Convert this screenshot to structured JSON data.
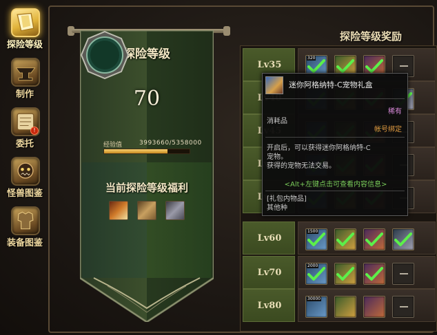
{
  "nav": {
    "items": [
      {
        "label": "探险等级",
        "active": true,
        "icon": "flag-icon"
      },
      {
        "label": "制作",
        "active": false,
        "icon": "anvil-icon"
      },
      {
        "label": "委托",
        "active": false,
        "icon": "scroll-icon",
        "badge": "!"
      },
      {
        "label": "怪兽图鉴",
        "active": false,
        "icon": "monster-icon"
      },
      {
        "label": "装备图鉴",
        "active": false,
        "icon": "armor-icon"
      }
    ]
  },
  "banner": {
    "title": "探险等级",
    "level": "70",
    "exp_label": "经验值",
    "exp_value": "3993660/5358000",
    "exp_fraction": 0.745,
    "benefit_title": "当前探险等级福利",
    "benefit_icons": [
      "sword-icon",
      "map-icon",
      "pet-icon"
    ]
  },
  "rewards": {
    "title": "探险等级奖励",
    "rows": [
      {
        "level": "Lv35",
        "slots": [
          {
            "qty": "320",
            "claimed": true
          },
          {
            "qty": "",
            "claimed": true
          },
          {
            "qty": "",
            "claimed": true
          },
          {
            "qty": "",
            "empty": true
          }
        ]
      },
      {
        "level": "Lv40",
        "slots": [
          {
            "qty": "",
            "claimed": true
          },
          {
            "qty": "",
            "claimed": true
          },
          {
            "qty": "",
            "claimed": true
          },
          {
            "qty": "",
            "claimed": true
          }
        ]
      },
      {
        "level": "Lv45",
        "slots": [
          {
            "qty": "",
            "claimed": true
          },
          {
            "qty": "",
            "claimed": true
          },
          {
            "qty": "",
            "claimed": true
          },
          {
            "qty": "",
            "empty": true
          }
        ]
      },
      {
        "level": "Lv50",
        "slots": [
          {
            "qty": "",
            "claimed": true
          },
          {
            "qty": "",
            "claimed": true
          },
          {
            "qty": "",
            "claimed": true
          },
          {
            "qty": "",
            "empty": true
          }
        ]
      },
      {
        "level": "Lv55",
        "slots": [
          {
            "qty": "",
            "claimed": true
          },
          {
            "qty": "",
            "claimed": true
          },
          {
            "qty": "",
            "claimed": true
          },
          {
            "qty": "",
            "empty": true
          }
        ]
      },
      {
        "level": "Lv60",
        "slots": [
          {
            "qty": "1500",
            "claimed": true
          },
          {
            "qty": "",
            "claimed": true
          },
          {
            "qty": "",
            "claimed": true
          },
          {
            "qty": "",
            "claimed": true
          }
        ]
      },
      {
        "level": "Lv70",
        "slots": [
          {
            "qty": "2000",
            "claimed": true
          },
          {
            "qty": "",
            "claimed": true
          },
          {
            "qty": "",
            "claimed": true
          },
          {
            "qty": "",
            "empty": true
          }
        ]
      },
      {
        "level": "Lv80",
        "slots": [
          {
            "qty": "30000",
            "claimed": false
          },
          {
            "qty": "",
            "claimed": false
          },
          {
            "qty": "",
            "claimed": false
          },
          {
            "qty": "",
            "empty": true
          }
        ]
      }
    ]
  },
  "tooltip": {
    "name": "迷你阿格纳特-C宠物礼盒",
    "rarity": "稀有",
    "type": "消耗品",
    "bind": "帐号绑定",
    "desc_line1": "开启后，可以获得迷你阿格纳特-C",
    "desc_line2": "宠物。",
    "desc_line3": "获得的宠物无法交易。",
    "hint": "<Alt+左键点击可查看内容信息>",
    "contents_label": "[礼包内物品]",
    "contents_value": "其他种",
    "colors": {
      "rarity": "#d88ad8",
      "bind": "#e09a40",
      "hint": "#7acc5a"
    }
  }
}
